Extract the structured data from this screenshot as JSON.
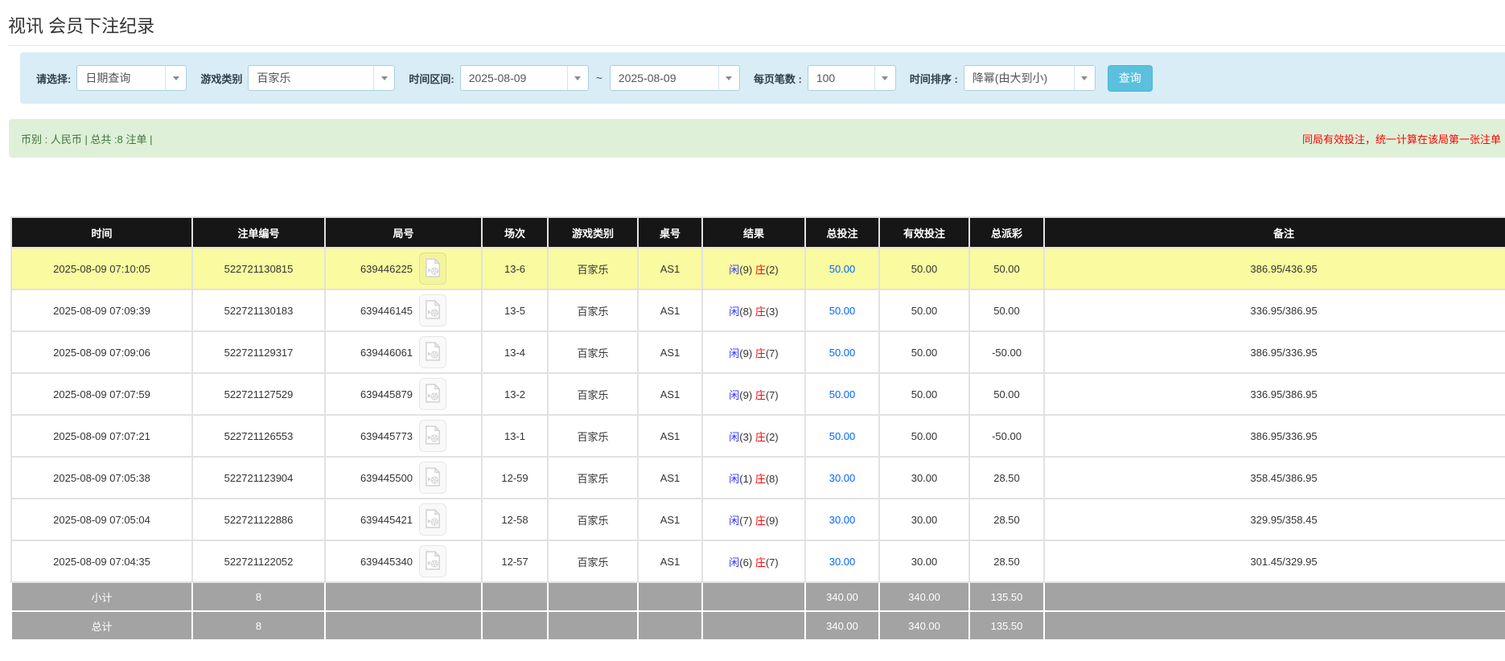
{
  "page": {
    "title": "视讯 会员下注纪录"
  },
  "colors": {
    "accent_button": "#5bc0de",
    "filter_bar_bg": "#d9edf7",
    "summary_bar_bg": "#dff0d8",
    "summary_text_green": "#3c763d",
    "note_red": "#ff0000",
    "table_header_bg": "#161616",
    "highlight_row_yellow": "#fafaa0",
    "footer_row_gray": "#a3a3a3",
    "player_blue": "#3333ff",
    "banker_red": "#ff0000",
    "bet_link_blue": "#0066ff"
  },
  "filter_bar": {
    "query_type_label": "请选择:",
    "query_type_value": "日期查询",
    "game_category_label": "游戏类别",
    "game_category_value": "百家乐",
    "time_range_label": "时间区间:",
    "date_from": "2025-08-09",
    "range_tilde": "~",
    "date_to": "2025-08-09",
    "page_size_label": "每页笔数 :",
    "page_size_value": "100",
    "time_sort_label": "时间排序 :",
    "time_sort_value": "降幂(由大到小)",
    "search_button_label": "查询"
  },
  "summary_bar": {
    "left_text": "币别 : 人民币 | 总共 :8 注单 |",
    "right_note": "同局有效投注，统一计算在该局第一张注单"
  },
  "table": {
    "columns": [
      "时间",
      "注单编号",
      "局号",
      "场次",
      "游戏类别",
      "桌号",
      "结果",
      "总投注",
      "有效投注",
      "总派彩",
      "备注"
    ],
    "column_keys": [
      "time",
      "bet-id",
      "round-id",
      "session",
      "game-category",
      "table-no",
      "result",
      "total-bet",
      "valid-bet",
      "payout",
      "remark"
    ],
    "icons": {
      "video_replay": "film-document-icon",
      "dropdown": "caret-down-icon"
    },
    "rows": [
      {
        "time": "2025-08-09 07:10:05",
        "bet_id": "522721130815",
        "round_id": "639446225",
        "session": "13-6",
        "game": "百家乐",
        "table_no": "AS1",
        "result": {
          "player_label": "闲",
          "player_num": "(9)",
          "banker_label": "庄",
          "banker_num": "(2)"
        },
        "total_bet": "50.00",
        "valid_bet": "50.00",
        "payout": "50.00",
        "payout_negative": false,
        "remark": "386.95/436.95",
        "highlighted": true
      },
      {
        "time": "2025-08-09 07:09:39",
        "bet_id": "522721130183",
        "round_id": "639446145",
        "session": "13-5",
        "game": "百家乐",
        "table_no": "AS1",
        "result": {
          "player_label": "闲",
          "player_num": "(8)",
          "banker_label": "庄",
          "banker_num": "(3)"
        },
        "total_bet": "50.00",
        "valid_bet": "50.00",
        "payout": "50.00",
        "payout_negative": false,
        "remark": "336.95/386.95",
        "highlighted": false
      },
      {
        "time": "2025-08-09 07:09:06",
        "bet_id": "522721129317",
        "round_id": "639446061",
        "session": "13-4",
        "game": "百家乐",
        "table_no": "AS1",
        "result": {
          "player_label": "闲",
          "player_num": "(9)",
          "banker_label": "庄",
          "banker_num": "(7)"
        },
        "total_bet": "50.00",
        "valid_bet": "50.00",
        "payout": "-50.00",
        "payout_negative": true,
        "remark": "386.95/336.95",
        "highlighted": false
      },
      {
        "time": "2025-08-09 07:07:59",
        "bet_id": "522721127529",
        "round_id": "639445879",
        "session": "13-2",
        "game": "百家乐",
        "table_no": "AS1",
        "result": {
          "player_label": "闲",
          "player_num": "(9)",
          "banker_label": "庄",
          "banker_num": "(7)"
        },
        "total_bet": "50.00",
        "valid_bet": "50.00",
        "payout": "50.00",
        "payout_negative": false,
        "remark": "336.95/386.95",
        "highlighted": false
      },
      {
        "time": "2025-08-09 07:07:21",
        "bet_id": "522721126553",
        "round_id": "639445773",
        "session": "13-1",
        "game": "百家乐",
        "table_no": "AS1",
        "result": {
          "player_label": "闲",
          "player_num": "(3)",
          "banker_label": "庄",
          "banker_num": "(2)"
        },
        "total_bet": "50.00",
        "valid_bet": "50.00",
        "payout": "-50.00",
        "payout_negative": true,
        "remark": "386.95/336.95",
        "highlighted": false
      },
      {
        "time": "2025-08-09 07:05:38",
        "bet_id": "522721123904",
        "round_id": "639445500",
        "session": "12-59",
        "game": "百家乐",
        "table_no": "AS1",
        "result": {
          "player_label": "闲",
          "player_num": "(1)",
          "banker_label": "庄",
          "banker_num": "(8)"
        },
        "total_bet": "30.00",
        "valid_bet": "30.00",
        "payout": "28.50",
        "payout_negative": false,
        "remark": "358.45/386.95",
        "highlighted": false
      },
      {
        "time": "2025-08-09 07:05:04",
        "bet_id": "522721122886",
        "round_id": "639445421",
        "session": "12-58",
        "game": "百家乐",
        "table_no": "AS1",
        "result": {
          "player_label": "闲",
          "player_num": "(7)",
          "banker_label": "庄",
          "banker_num": "(9)"
        },
        "total_bet": "30.00",
        "valid_bet": "30.00",
        "payout": "28.50",
        "payout_negative": false,
        "remark": "329.95/358.45",
        "highlighted": false
      },
      {
        "time": "2025-08-09 07:04:35",
        "bet_id": "522721122052",
        "round_id": "639445340",
        "session": "12-57",
        "game": "百家乐",
        "table_no": "AS1",
        "result": {
          "player_label": "闲",
          "player_num": "(6)",
          "banker_label": "庄",
          "banker_num": "(7)"
        },
        "total_bet": "30.00",
        "valid_bet": "30.00",
        "payout": "28.50",
        "payout_negative": false,
        "remark": "301.45/329.95",
        "highlighted": false
      }
    ],
    "footer_rows": [
      {
        "label": "小计",
        "count": "8",
        "total_bet": "340.00",
        "valid_bet": "340.00",
        "payout": "135.50"
      },
      {
        "label": "总计",
        "count": "8",
        "total_bet": "340.00",
        "valid_bet": "340.00",
        "payout": "135.50"
      }
    ]
  }
}
